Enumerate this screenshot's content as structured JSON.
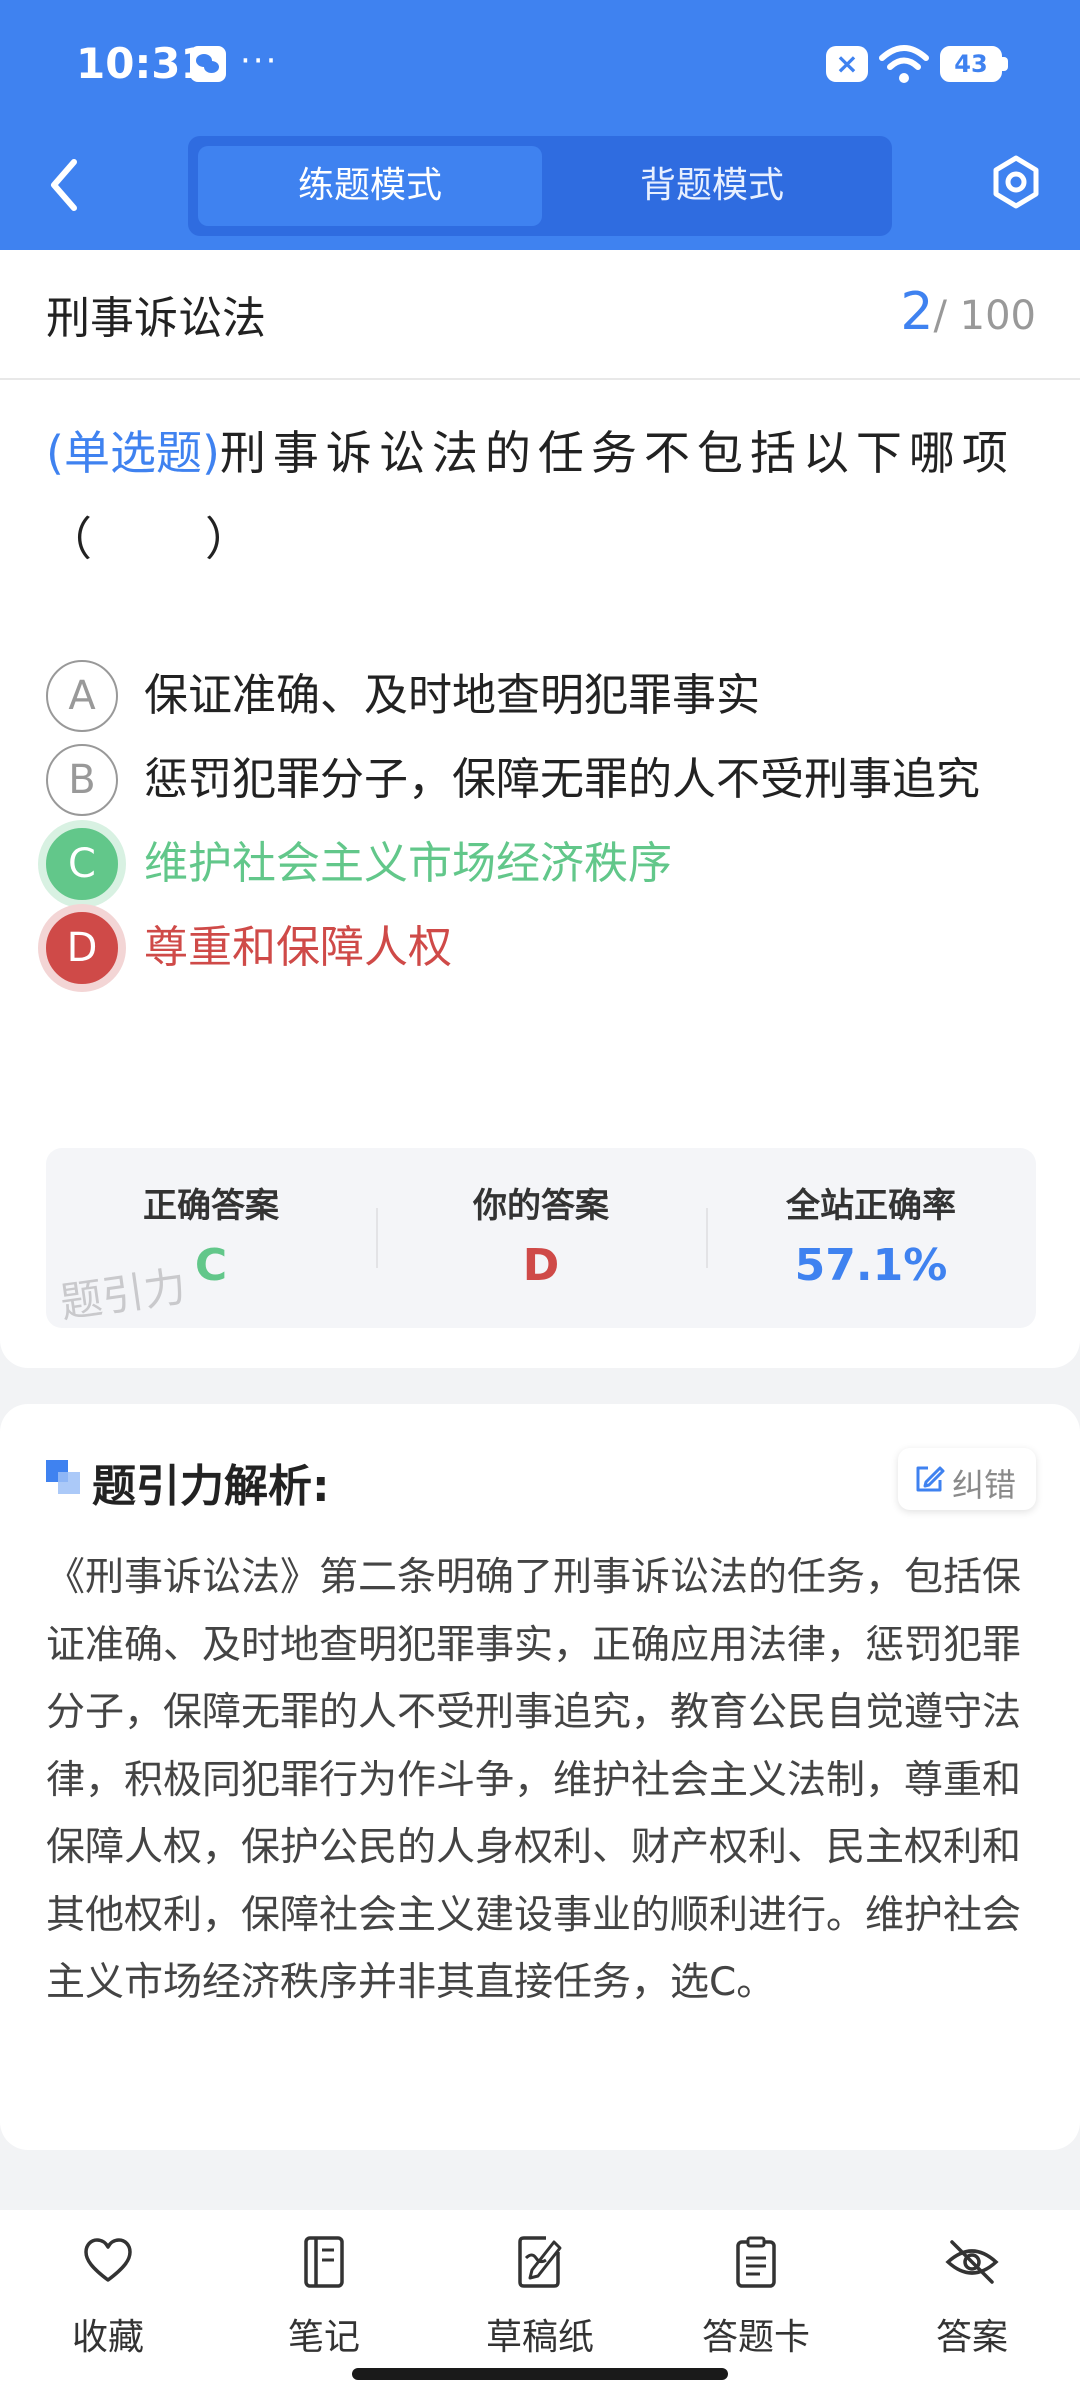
{
  "status_bar": {
    "time": "10:31",
    "dots": "···",
    "battery": "43"
  },
  "header": {
    "tabs": [
      {
        "label": "练题模式",
        "active": true
      },
      {
        "label": "背题模式",
        "active": false
      }
    ]
  },
  "question_card": {
    "subject": "刑事诉讼法",
    "counter_current": "2",
    "counter_total": "/ 100",
    "question_type": "(单选题)",
    "question_text": "刑事诉讼法的任务不包括以下哪项（　　）",
    "options": [
      {
        "letter": "A",
        "text": "保证准确、及时地查明犯罪事实",
        "state": "normal"
      },
      {
        "letter": "B",
        "text": "惩罚犯罪分子，保障无罪的人不受刑事追究",
        "state": "normal"
      },
      {
        "letter": "C",
        "text": "维护社会主义市场经济秩序",
        "state": "correct"
      },
      {
        "letter": "D",
        "text": "尊重和保障人权",
        "state": "wrong"
      }
    ],
    "stats": [
      {
        "label": "正确答案",
        "value": "C",
        "color": "#62c78a"
      },
      {
        "label": "你的答案",
        "value": "D",
        "color": "#cf4a48"
      },
      {
        "label": "全站正确率",
        "value": "57.1%",
        "color": "#3f82f0"
      }
    ],
    "watermark": "题引力"
  },
  "analysis": {
    "title": "题引力解析:",
    "correct_button": "纠错",
    "text": "《刑事诉讼法》第二条明确了刑事诉讼法的任务，包括保证准确、及时地查明犯罪事实，正确应用法律，惩罚犯罪分子，保障无罪的人不受刑事追究，教育公民自觉遵守法律，积极同犯罪行为作斗争，维护社会主义法制，尊重和保障人权，保护公民的人身权利、财产权利、民主权利和其他权利，保障社会主义建设事业的顺利进行。维护社会主义市场经济秩序并非其直接任务，选C。"
  },
  "bottom_nav": [
    {
      "label": "收藏",
      "icon": "heart-icon"
    },
    {
      "label": "笔记",
      "icon": "notebook-icon"
    },
    {
      "label": "草稿纸",
      "icon": "draft-icon"
    },
    {
      "label": "答题卡",
      "icon": "clipboard-icon"
    },
    {
      "label": "答案",
      "icon": "eye-off-icon"
    }
  ],
  "colors": {
    "primary": "#3f82f0",
    "correct": "#62c78a",
    "wrong": "#cf4a48"
  }
}
